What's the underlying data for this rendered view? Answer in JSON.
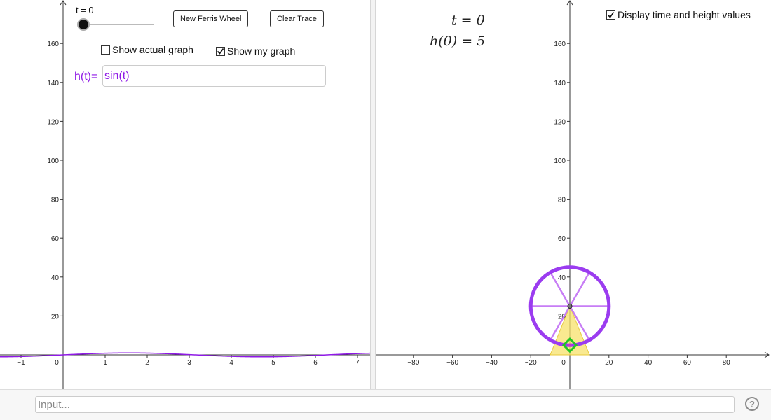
{
  "left_graph": {
    "x_ticks": [
      "−1",
      "0",
      "1",
      "2",
      "3",
      "4",
      "5",
      "6",
      "7"
    ],
    "y_ticks": [
      "20",
      "40",
      "60",
      "80",
      "100",
      "120",
      "140",
      "160"
    ],
    "slider": {
      "label": "t = 0",
      "value": 0
    },
    "buttons": {
      "new_ferris_wheel": "New Ferris Wheel",
      "clear_trace": "Clear Trace"
    },
    "checkboxes": {
      "show_actual_graph": {
        "label": "Show actual graph",
        "checked": false
      },
      "show_my_graph": {
        "label": "Show my graph",
        "checked": true
      }
    },
    "function": {
      "label": "h(t)=",
      "value": "sin(t)",
      "color": "#8f19e6"
    }
  },
  "right_graph": {
    "x_ticks": [
      "−80",
      "−60",
      "−40",
      "−20",
      "0",
      "20",
      "40",
      "60",
      "80"
    ],
    "y_ticks": [
      "20",
      "40",
      "60",
      "80",
      "100",
      "120",
      "140",
      "160"
    ],
    "time_text": "t = 0",
    "height_text": "h(0) = 5",
    "display_checkbox": {
      "label": "Display time and height values",
      "checked": true
    },
    "ferris_wheel": {
      "center_height": 25,
      "radius": 20,
      "rim_color": "#9b3cf0",
      "spoke_color": "#c77df5",
      "support_color": "#f7e16b",
      "car_color": "#22c522"
    }
  },
  "input_bar": {
    "placeholder": "Input..."
  },
  "help_icon": "?"
}
